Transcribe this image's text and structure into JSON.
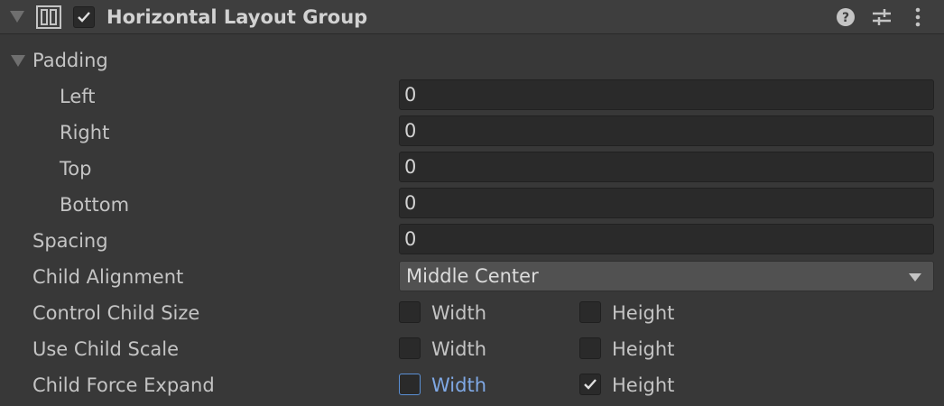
{
  "component": {
    "title": "Horizontal Layout Group",
    "enabled": true,
    "icon": "horizontal-layout-icon",
    "header_icons": [
      "help-icon",
      "presets-icon",
      "more-options-icon"
    ]
  },
  "padding": {
    "label": "Padding",
    "expanded": true,
    "fields": [
      {
        "label": "Left",
        "value": "0"
      },
      {
        "label": "Right",
        "value": "0"
      },
      {
        "label": "Top",
        "value": "0"
      },
      {
        "label": "Bottom",
        "value": "0"
      }
    ]
  },
  "spacing": {
    "label": "Spacing",
    "value": "0"
  },
  "child_alignment": {
    "label": "Child Alignment",
    "value": "Middle Center"
  },
  "toggles": [
    {
      "label": "Control Child Size",
      "width_label": "Width",
      "width_checked": false,
      "height_label": "Height",
      "height_checked": false
    },
    {
      "label": "Use Child Scale",
      "width_label": "Width",
      "width_checked": false,
      "height_label": "Height",
      "height_checked": false
    },
    {
      "label": "Child Force Expand",
      "width_label": "Width",
      "width_checked": false,
      "height_label": "Height",
      "height_checked": true
    }
  ],
  "colors": {
    "background": "#383838",
    "header": "#3e3e3e",
    "field": "#2a2a2a",
    "focus": "#5a8fd4"
  }
}
